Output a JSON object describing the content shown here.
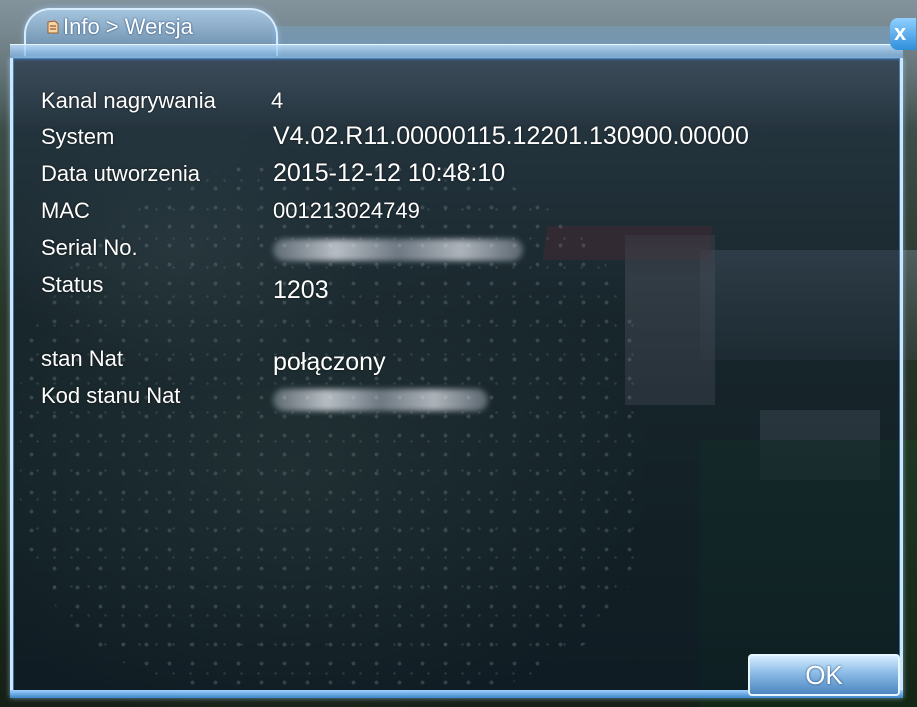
{
  "window": {
    "title": "Info > Wersja",
    "close_label": "x"
  },
  "info": {
    "rows": [
      {
        "label": "Kanal nagrywania",
        "value": "4"
      },
      {
        "label": "System",
        "value": "V4.02.R11.00000115.12201.130900.00000"
      },
      {
        "label": "Data utworzenia",
        "value": "2015-12-12 10:48:10"
      },
      {
        "label": "MAC",
        "value": "001213024749"
      },
      {
        "label": "Serial No.",
        "value": ""
      },
      {
        "label": "Status",
        "value": "1203"
      },
      {
        "label": "stan Nat",
        "value": "połączony"
      },
      {
        "label": "Kod stanu Nat",
        "value": ""
      }
    ]
  },
  "buttons": {
    "ok_label": "OK"
  },
  "colors": {
    "accent": "#8fc6f5",
    "panel_border": "#cbe6ff",
    "text": "#ffffff"
  },
  "icons": {
    "title": "info-app-icon",
    "close": "close-icon"
  }
}
